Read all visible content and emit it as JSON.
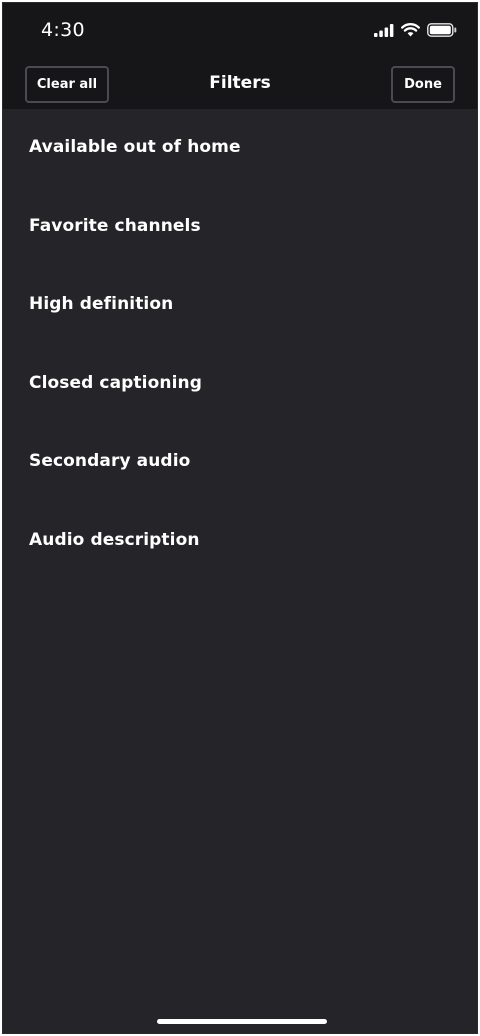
{
  "status_bar": {
    "time": "4:30",
    "icons": [
      "cellular-signal-icon",
      "wifi-icon",
      "battery-icon"
    ]
  },
  "nav": {
    "clear_label": "Clear all",
    "title": "Filters",
    "done_label": "Done"
  },
  "filters": [
    {
      "label": "Available out of home"
    },
    {
      "label": "Favorite channels"
    },
    {
      "label": "High definition"
    },
    {
      "label": "Closed captioning"
    },
    {
      "label": "Secondary audio"
    },
    {
      "label": "Audio description"
    }
  ],
  "colors": {
    "background": "#242429",
    "header": "#161618",
    "text": "#ffffff",
    "button_border": "#4a4a50"
  }
}
